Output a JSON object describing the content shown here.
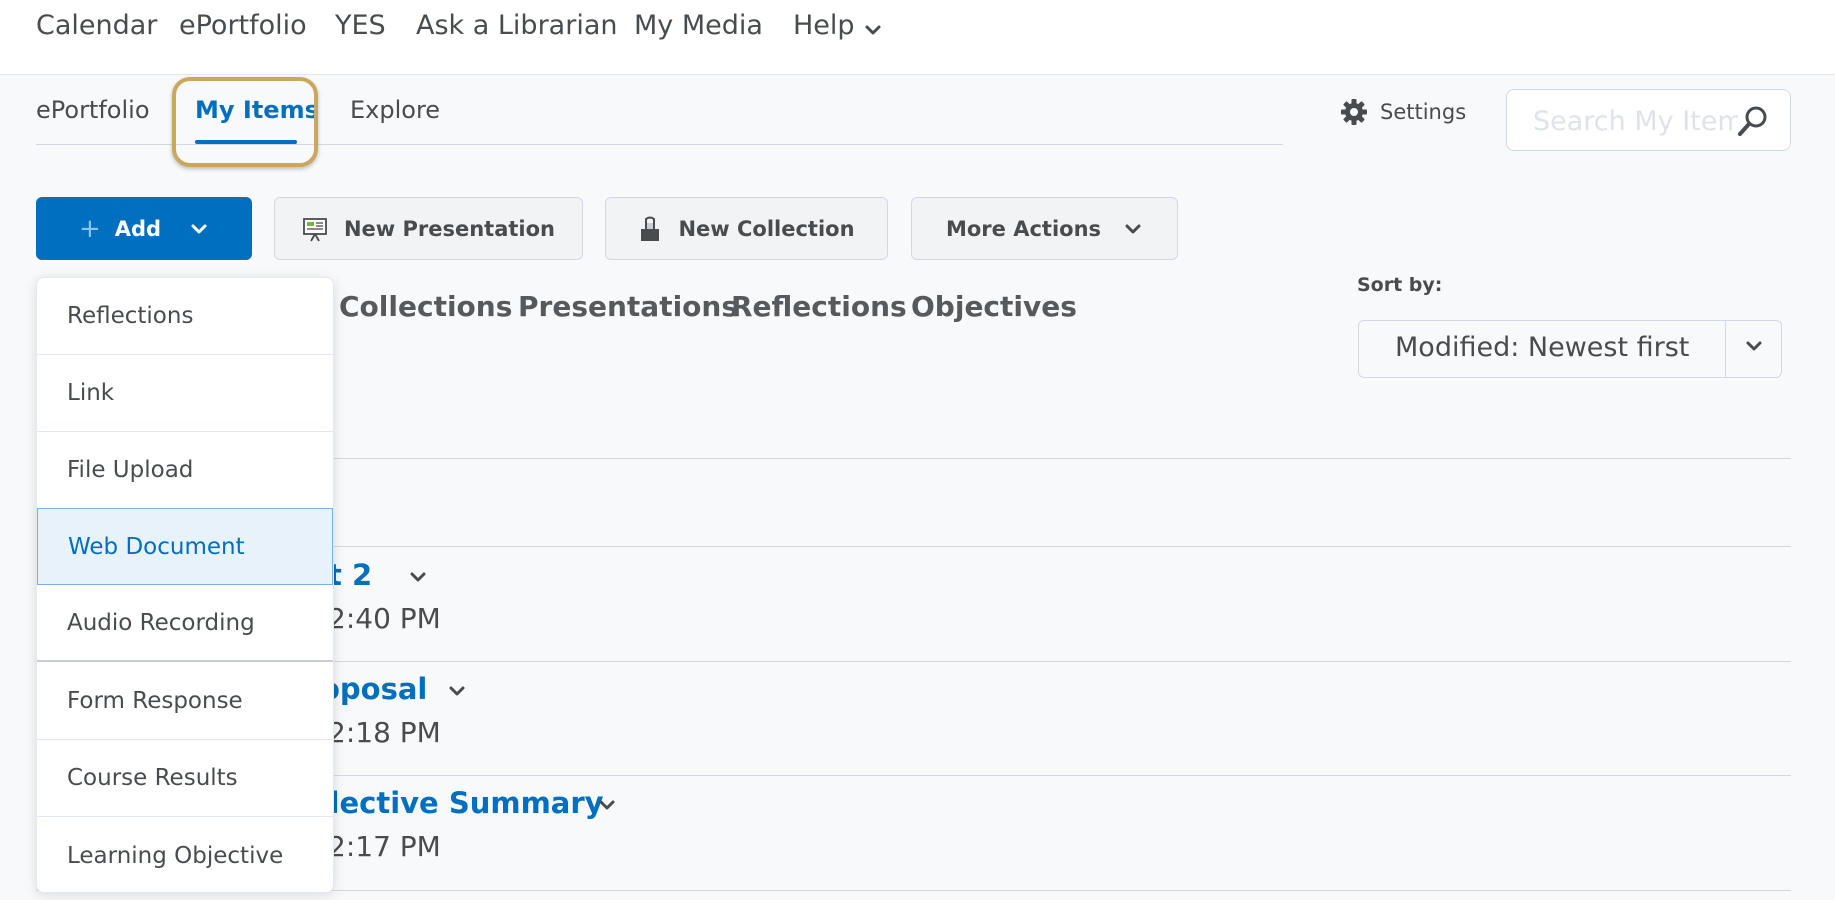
{
  "top_nav": {
    "items": [
      "Calendar",
      "ePortfolio",
      "YES",
      "Ask a Librarian",
      "My Media",
      "Help"
    ]
  },
  "sub_nav": {
    "tabs": [
      "ePortfolio",
      "My Items",
      "Explore"
    ],
    "active": "My Items",
    "settings_label": "Settings",
    "search_placeholder": "Search My Items"
  },
  "toolbar": {
    "add_label": "Add",
    "new_presentation_label": "New Presentation",
    "new_collection_label": "New Collection",
    "more_actions_label": "More Actions"
  },
  "filters": {
    "tabs": [
      "Collections",
      "Presentations",
      "Reflections",
      "Objectives"
    ]
  },
  "sort": {
    "label": "Sort by:",
    "value": "Modified: Newest first"
  },
  "items": [
    {
      "title_fragment": "t 2",
      "time_fragment": "2:40 PM"
    },
    {
      "title_fragment": "oposal",
      "time_fragment": "2:18 PM"
    },
    {
      "title_fragment": "flective Summary",
      "time_fragment": "2:17 PM"
    }
  ],
  "add_menu": {
    "items": [
      "Reflections",
      "Link",
      "File Upload",
      "Web Document",
      "Audio Recording",
      "Form Response",
      "Course Results",
      "Learning Objective"
    ],
    "highlighted": "Web Document"
  },
  "colors": {
    "accent": "#006fbf",
    "highlight_ring": "#c9a75c",
    "text": "#494c4e"
  }
}
